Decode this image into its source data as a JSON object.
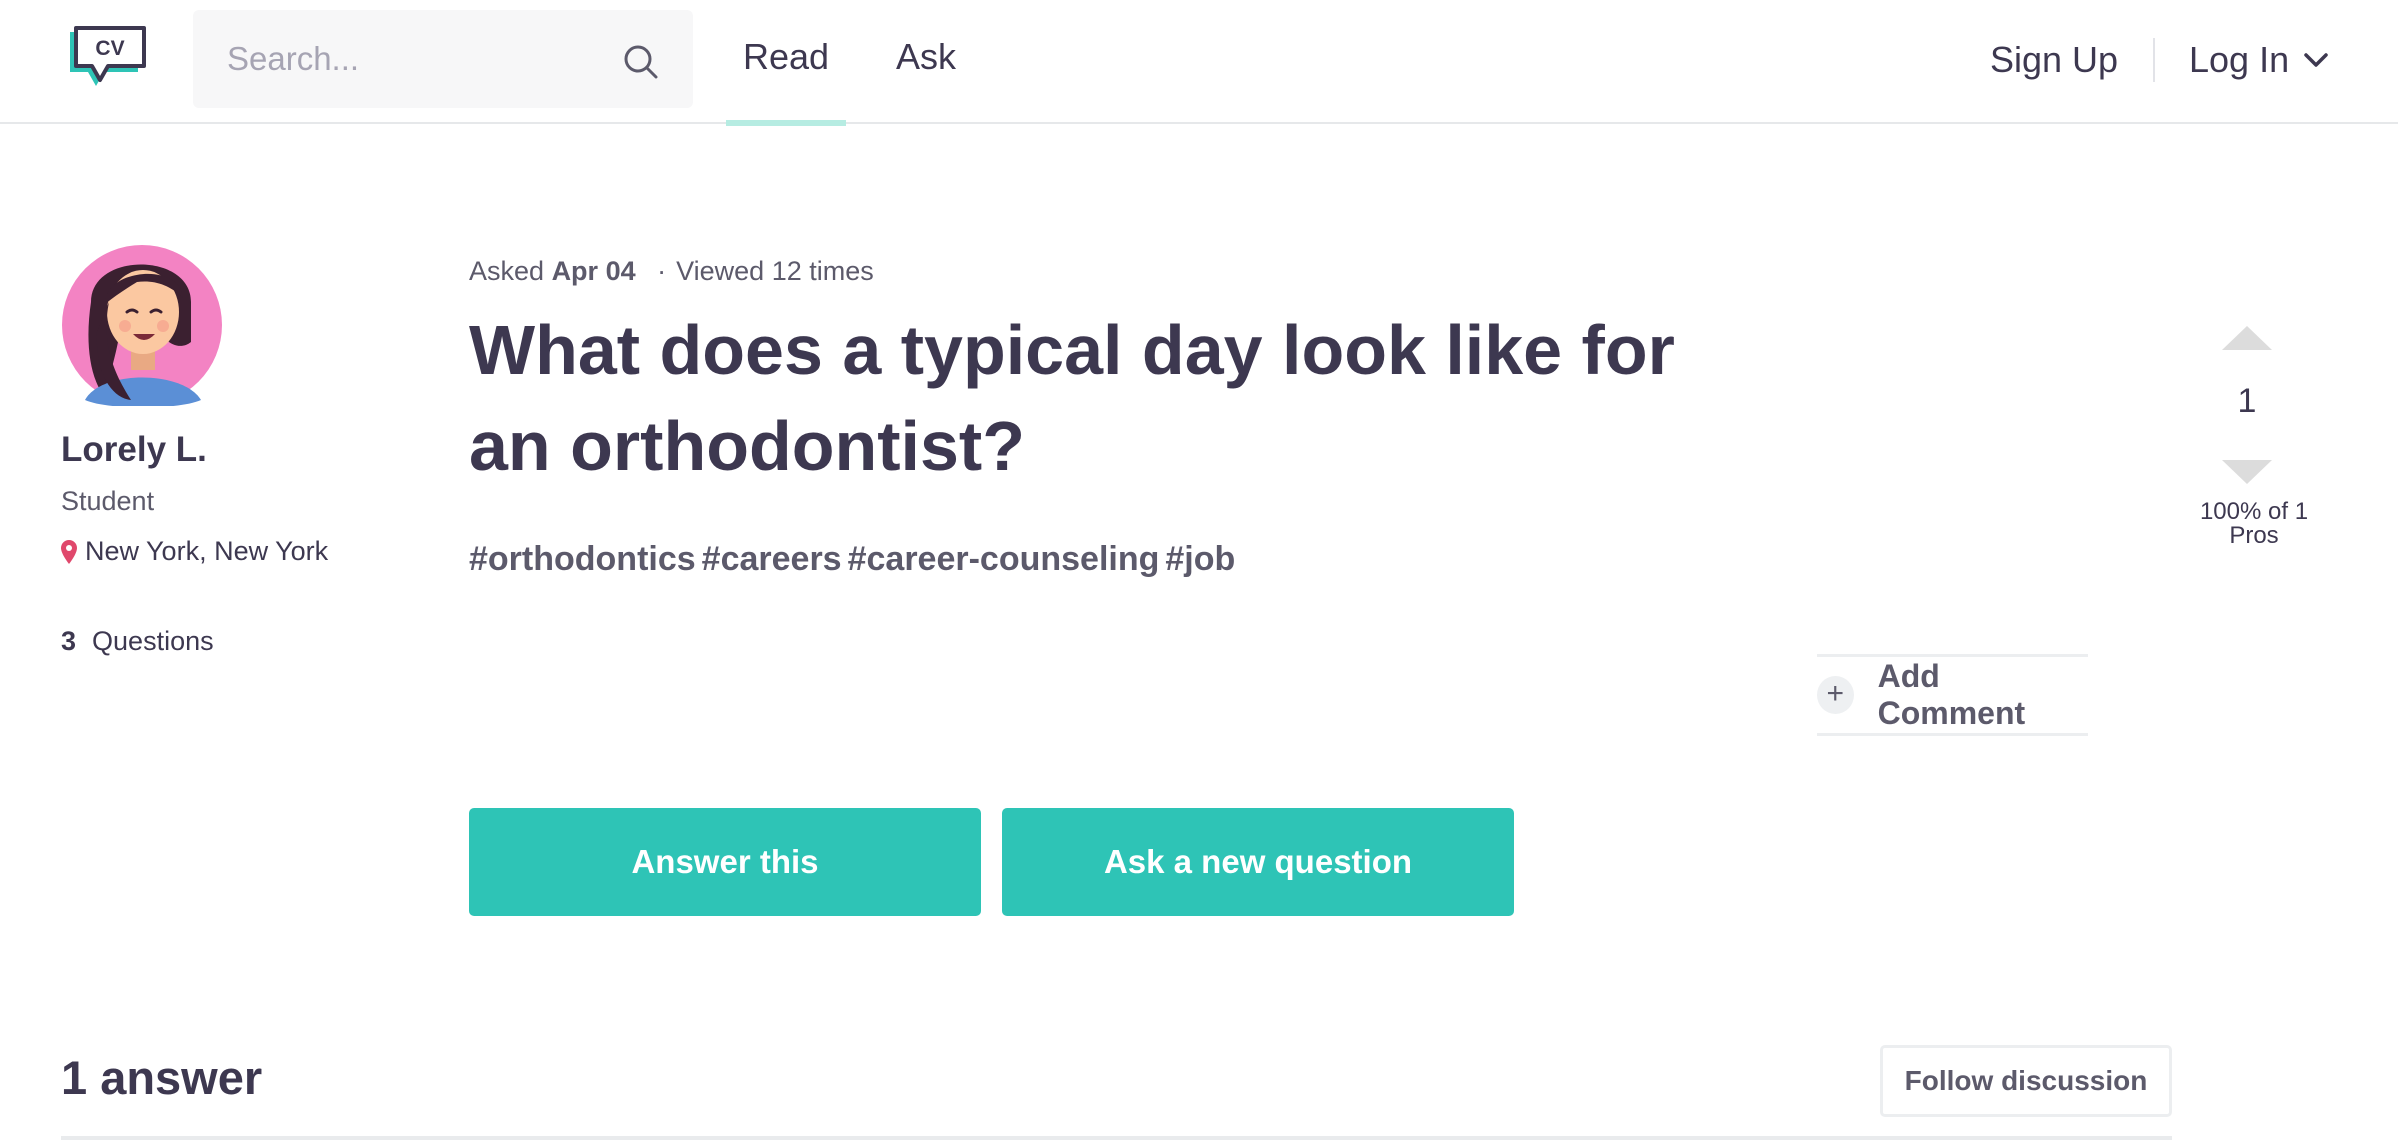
{
  "header": {
    "logo_text": "CV",
    "search": {
      "placeholder": "Search...",
      "value": ""
    },
    "tabs": [
      {
        "label": "Read",
        "active": true
      },
      {
        "label": "Ask",
        "active": false
      }
    ],
    "signup_label": "Sign Up",
    "login_label": "Log In"
  },
  "author": {
    "name": "Lorely L.",
    "role": "Student",
    "location": "New York, New York",
    "questions_count": "3",
    "questions_label": "Questions"
  },
  "question": {
    "asked_prefix": "Asked",
    "asked_date": "Apr 04",
    "separator": "·",
    "views": "Viewed 12 times",
    "title": "What does a typical day look like for an orthodontist?",
    "tags": [
      "#orthodontics",
      "#careers",
      "#career-counseling",
      "#job"
    ]
  },
  "vote": {
    "count": "1",
    "pros_line1": "100% of 1",
    "pros_line2": "Pros"
  },
  "actions": {
    "add_comment": "Add Comment",
    "plus_symbol": "+",
    "answer_this": "Answer this",
    "ask_new": "Ask a new question"
  },
  "answers": {
    "heading": "1 answer",
    "follow_label": "Follow discussion"
  },
  "colors": {
    "accent": "#2ec4b6",
    "tab_underline": "#b6ece2",
    "text_dark": "#3d3850",
    "text_muted": "#5c5a6b",
    "avatar_bg": "#f383c3",
    "pin": "#e0486c"
  },
  "icons": {
    "logo": "cv-speech-bubble-logo",
    "search": "search-icon",
    "login_chevron": "chevron-down-icon",
    "location": "map-pin-icon",
    "vote_up": "triangle-up-icon",
    "vote_down": "triangle-down-icon",
    "comment": "plus-icon"
  }
}
